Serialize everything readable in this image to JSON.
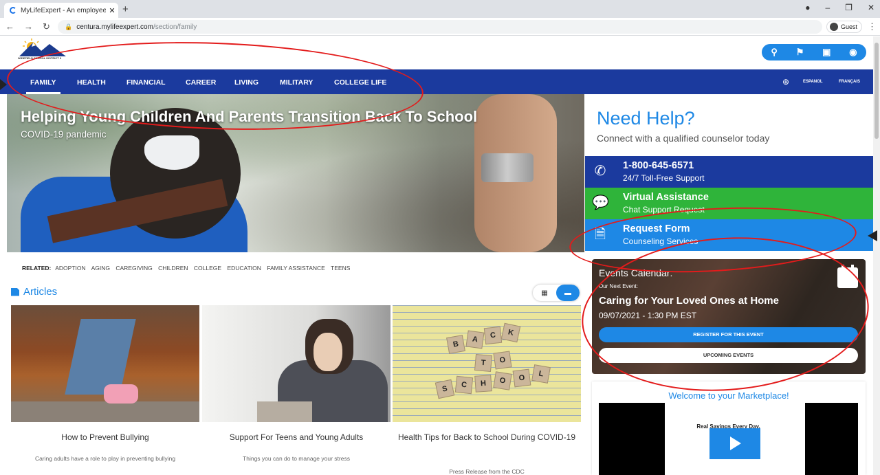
{
  "browser": {
    "tab_title": "MyLifeExpert - An employee well",
    "url_host": "centura.mylifeexpert.com",
    "url_path": "/section/family",
    "profile_label": "Guest"
  },
  "site": {
    "logo_text": "WIDEFIELD SCHOOL DISTRICT 3",
    "nav": [
      "FAMILY",
      "HEALTH",
      "FINANCIAL",
      "CAREER",
      "LIVING",
      "MILITARY",
      "COLLEGE LIFE"
    ],
    "languages": [
      "ESPANOL",
      "FRANÇAIS"
    ]
  },
  "hero": {
    "title": "Helping Young Children And Parents Transition Back To School",
    "subtitle": "COVID-19 pandemic"
  },
  "related": {
    "label": "RELATED:",
    "tags": [
      "ADOPTION",
      "AGING",
      "CAREGIVING",
      "CHILDREN",
      "COLLEGE",
      "EDUCATION",
      "FAMILY ASSISTANCE",
      "TEENS"
    ]
  },
  "articles": {
    "heading": "Articles",
    "items": [
      {
        "title": "How to Prevent Bullying",
        "desc": "Caring adults have a role to play in preventing bullying"
      },
      {
        "title": "Support For Teens and Young Adults",
        "desc": "Things you can do to manage your stress"
      },
      {
        "title": "Health Tips for Back to School During COVID-19",
        "desc": "Press Release from the CDC"
      }
    ],
    "tiles": [
      "B",
      "A",
      "C",
      "K",
      "T",
      "O",
      "S",
      "C",
      "H",
      "O",
      "O",
      "L"
    ]
  },
  "help": {
    "title": "Need Help?",
    "subtitle": "Connect with a qualified counselor today",
    "phone": {
      "title": "1-800-645-6571",
      "sub": "24/7 Toll-Free Support"
    },
    "chat": {
      "title": "Virtual Assistance",
      "sub": "Chat Support Request"
    },
    "form": {
      "title": "Request Form",
      "sub": "Counseling Services"
    }
  },
  "events": {
    "title": "Events Calendar:",
    "next_label": "Our Next Event:",
    "name": "Caring for Your Loved Ones at Home",
    "datetime": "09/07/2021 - 1:30 PM EST",
    "register_label": "REGISTER FOR THIS EVENT",
    "upcoming_label": "UPCOMING EVENTS"
  },
  "marketplace": {
    "title": "Welcome to your Marketplace!",
    "video_caption": "Real Savings Every Day."
  },
  "colors": {
    "nav_blue": "#1b3a9e",
    "accent_blue": "#1e88e5",
    "chat_green": "#2fb43a",
    "annotation_red": "#e31b1b"
  }
}
